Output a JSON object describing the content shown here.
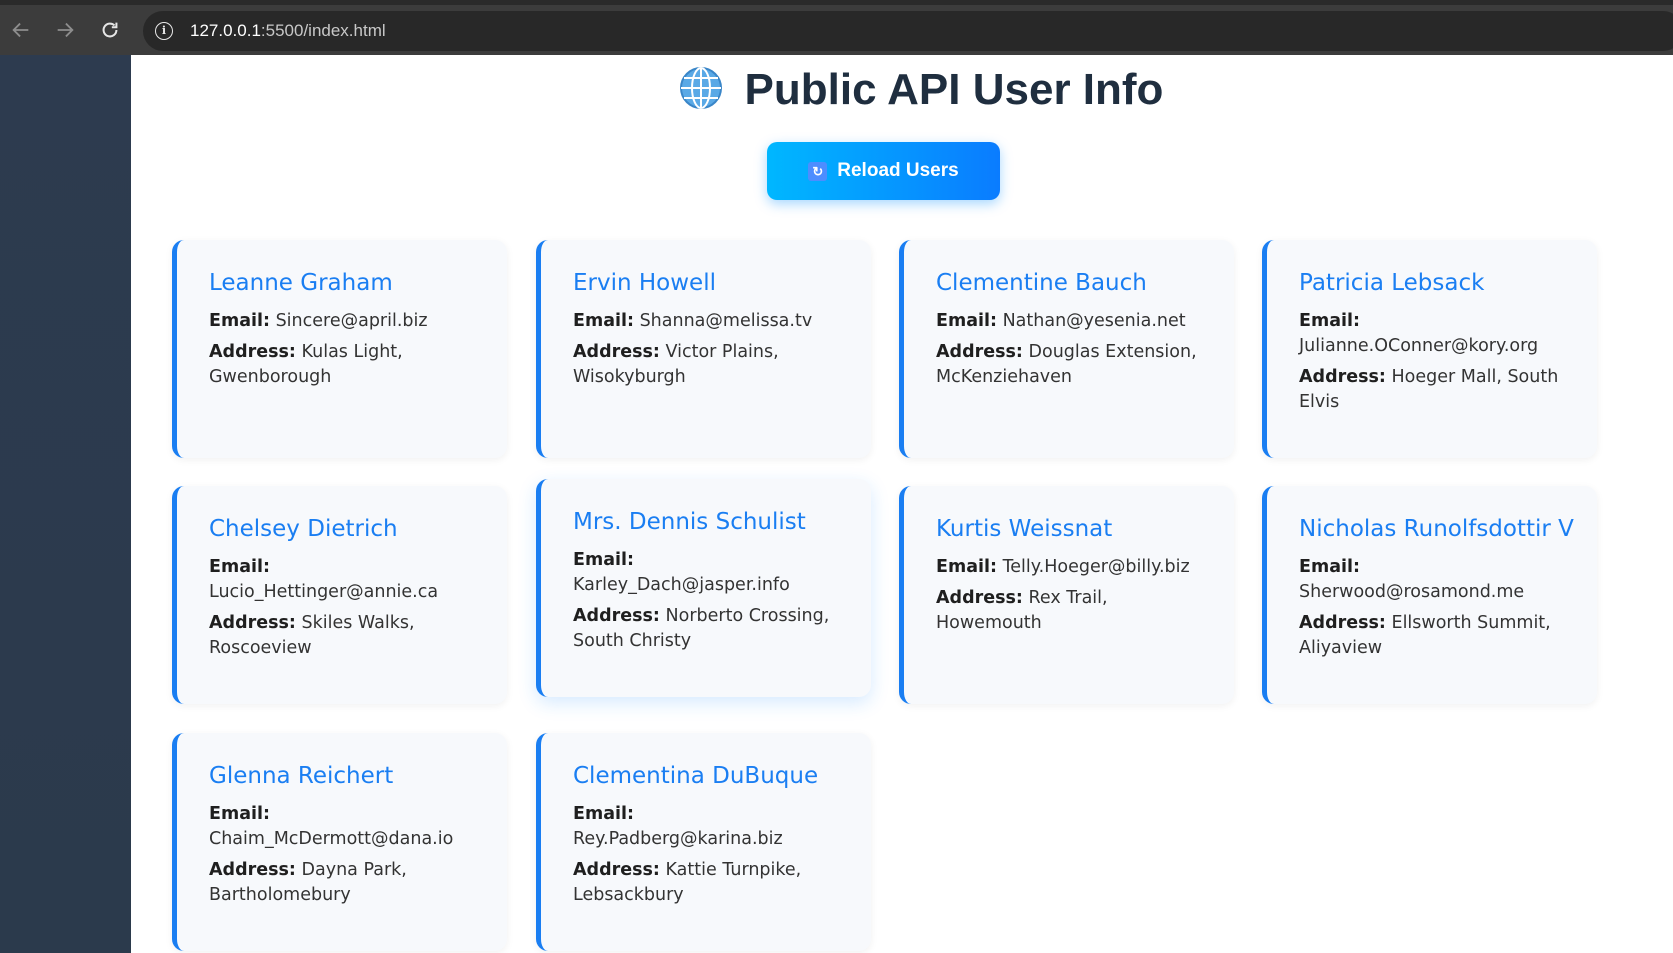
{
  "browser": {
    "url_host": "127.0.0.1",
    "url_rest": ":5500/index.html"
  },
  "page": {
    "title": "Public API User Info",
    "reload_label": "Reload Users",
    "email_label": "Email:",
    "address_label": "Address:"
  },
  "users": [
    {
      "name": "Leanne Graham",
      "email": "Sincere@april.biz",
      "address": "Kulas Light, Gwenborough"
    },
    {
      "name": "Ervin Howell",
      "email": "Shanna@melissa.tv",
      "address": "Victor Plains, Wisokyburgh"
    },
    {
      "name": "Clementine Bauch",
      "email": "Nathan@yesenia.net",
      "address": "Douglas Extension, McKenziehaven"
    },
    {
      "name": "Patricia Lebsack",
      "email": "Julianne.OConner@kory.org",
      "address": "Hoeger Mall, South Elvis"
    },
    {
      "name": "Chelsey Dietrich",
      "email": "Lucio_Hettinger@annie.ca",
      "address": "Skiles Walks, Roscoeview"
    },
    {
      "name": "Mrs. Dennis Schulist",
      "email": "Karley_Dach@jasper.info",
      "address": "Norberto Crossing, South Christy"
    },
    {
      "name": "Kurtis Weissnat",
      "email": "Telly.Hoeger@billy.biz",
      "address": "Rex Trail, Howemouth"
    },
    {
      "name": "Nicholas Runolfsdottir V",
      "email": "Sherwood@rosamond.me",
      "address": "Ellsworth Summit, Aliyaview"
    },
    {
      "name": "Glenna Reichert",
      "email": "Chaim_McDermott@dana.io",
      "address": "Dayna Park, Bartholomebury"
    },
    {
      "name": "Clementina DuBuque",
      "email": "Rey.Padberg@karina.biz",
      "address": "Kattie Turnpike, Lebsackbury"
    }
  ],
  "colors": {
    "accent": "#1a7ef2",
    "sidebar": "#2d3b4f",
    "title": "#1f2e3f"
  }
}
